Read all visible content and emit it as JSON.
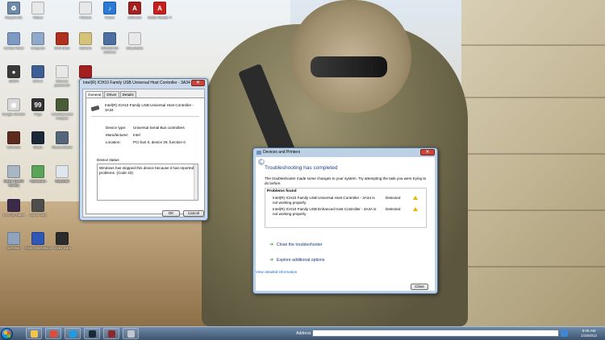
{
  "desktop": {
    "icons": [
      {
        "label": "Recycle Bin",
        "color": "#6f8aa8",
        "glyph": "♻"
      },
      {
        "label": "Videos",
        "color": "#e8e8e8",
        "glyph": ""
      },
      {
        "label": "Pictures",
        "color": "#e8e8e8",
        "glyph": ""
      },
      {
        "label": "iTunes",
        "color": "#2a7bd8",
        "glyph": "♪"
      },
      {
        "label": "Unknown",
        "color": "#a51f1f",
        "glyph": "A"
      },
      {
        "label": "Adobe Reader X",
        "color": "#c81e1e",
        "glyph": "A"
      },
      {
        "label": "Control Panel",
        "color": "#7d9ac4",
        "glyph": ""
      },
      {
        "label": "Computer",
        "color": "#8fa9c8",
        "glyph": ""
      },
      {
        "label": "DVD Drive",
        "color": "#b0301e",
        "glyph": ""
      },
      {
        "label": "Network",
        "color": "#d7c27a",
        "glyph": ""
      },
      {
        "label": "SPEEDFAN Shortcut",
        "color": "#4c6fa2",
        "glyph": ""
      },
      {
        "label": "Documents",
        "color": "#e8e8e8",
        "glyph": ""
      },
      {
        "label": "AIMP3",
        "color": "#3a3a3a",
        "glyph": "●"
      },
      {
        "label": "CPU-Z",
        "color": "#3e5f96",
        "glyph": ""
      },
      {
        "label": "Remove passwords",
        "color": "#e8e8e8",
        "glyph": ""
      },
      {
        "label": "Unknown",
        "color": "#a51f1f",
        "glyph": ""
      },
      {
        "label": "Google Chrome",
        "color": "#d9d9d9",
        "glyph": "◉"
      },
      {
        "label": "Pogo",
        "color": "#333333",
        "glyph": "99"
      },
      {
        "label": "Command and Conquer",
        "color": "#4a5b3a",
        "glyph": ""
      },
      {
        "label": "Unknown",
        "color": "#5c2a1e",
        "glyph": ""
      },
      {
        "label": "Steam",
        "color": "#1b2838",
        "glyph": ""
      },
      {
        "label": "Mouse Effects",
        "color": "#55667a",
        "glyph": ""
      },
      {
        "label": "Digital Sports Gaming",
        "color": "#2a3c5e",
        "glyph": ""
      },
      {
        "label": "Unknown",
        "color": "#5b4a2c",
        "glyph": ""
      },
      {
        "label": "Keyboard",
        "color": "#b9c8d6",
        "glyph": ""
      },
      {
        "label": "1 HD 3D Game",
        "color": "#3b2a4a",
        "glyph": ""
      },
      {
        "label": "Call of Duty",
        "color": "#4e4e4e",
        "glyph": ""
      },
      {
        "label": "Speedfan",
        "color": "#8fa3bd",
        "glyph": ""
      },
      {
        "label": "Sonic Generations",
        "color": "#2f57b5",
        "glyph": ""
      },
      {
        "label": "Crysis Wars",
        "color": "#2b2b2b",
        "glyph": ""
      },
      {
        "label": "Canon IP1800 series",
        "color": "#a8b6c6",
        "glyph": ""
      },
      {
        "label": "Retrostrada",
        "color": "#5aa55a",
        "glyph": ""
      },
      {
        "label": "Cell chart",
        "color": "#dfe6ee",
        "glyph": ""
      }
    ]
  },
  "properties_dialog": {
    "title": "Intel(R) ICH10 Family USB Universal Host Controller - 3A34 Prop...",
    "close_glyph": "✕",
    "tabs": [
      "General",
      "Driver",
      "Details"
    ],
    "device_name": "Intel(R) ICH10 Family USB Universal Host Controller - 3A34",
    "fields": [
      {
        "key": "Device type:",
        "value": "Universal Serial Bus controllers"
      },
      {
        "key": "Manufacturer:",
        "value": "Intel"
      },
      {
        "key": "Location:",
        "value": "PCI bus 0, device 29, function 0"
      }
    ],
    "status_legend": "Device status",
    "status_text": "Windows has stopped this device because it has reported problems. (Code 43)",
    "ok_label": "OK",
    "cancel_label": "Cancel"
  },
  "troubleshooter": {
    "window_title": "Devices and Printers",
    "close_glyph": "✕",
    "back_glyph": "◀",
    "heading": "Troubleshooting has completed",
    "description": "The troubleshooter made some changes to your system. Try attempting the task you were trying to do before.",
    "problems_header": "Problems found",
    "problems": [
      {
        "name": "Intel(R) ICH10 Family USB Universal Host Controller - 3A34 is not working properly",
        "status": "Detected"
      },
      {
        "name": "Intel(R) ICH10 Family USB Enhanced Host Controller - 3A3A is not working properly",
        "status": "Detected"
      }
    ],
    "options": [
      {
        "arrow": "➜",
        "label": "Close the troubleshooter"
      },
      {
        "arrow": "➜",
        "label": "Explore additional options"
      }
    ],
    "detail_link": "View detailed information",
    "close_button": "Close"
  },
  "taskbar": {
    "address_label": "Address",
    "clock_time": "9:05 AM",
    "clock_date": "1/19/2012",
    "pinned": [
      {
        "name": "windows-explorer",
        "color": "#f0c34a"
      },
      {
        "name": "chrome",
        "color": "#e04b3a"
      },
      {
        "name": "skype",
        "color": "#1e9be3"
      },
      {
        "name": "steam",
        "color": "#1b2838"
      },
      {
        "name": "game",
        "color": "#8b2a2a"
      },
      {
        "name": "tool",
        "color": "#c0c6cf"
      }
    ]
  }
}
